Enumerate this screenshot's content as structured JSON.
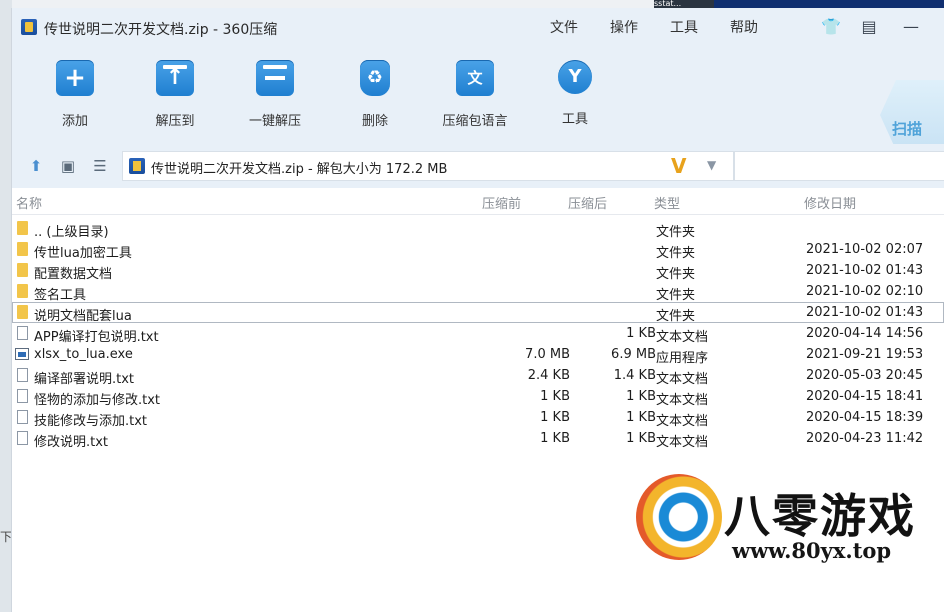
{
  "window": {
    "title": "传世说明二次开发文档.zip - 360压缩",
    "background_tab": "sstat..."
  },
  "menu": {
    "file": "文件",
    "operation": "操作",
    "tools": "工具",
    "help": "帮助"
  },
  "toolbar": {
    "add": "添加",
    "extract_to": "解压到",
    "one_click_extract": "一键解压",
    "delete": "删除",
    "archive_language": "压缩包语言",
    "tools": "工具",
    "scan": "扫描"
  },
  "address": {
    "path": "传世说明二次开发文档.zip - 解包大小为 172.2 MB",
    "vip": "V"
  },
  "columns": {
    "name": "名称",
    "compressed": "压缩前",
    "original": "压缩后",
    "type": "类型",
    "modified": "修改日期"
  },
  "rows": [
    {
      "name": ".. (上级目录)",
      "compressed": "",
      "original": "",
      "type": "文件夹",
      "date": "",
      "kind": "folder"
    },
    {
      "name": "传世lua加密工具",
      "compressed": "",
      "original": "",
      "type": "文件夹",
      "date": "2021-10-02 02:07",
      "kind": "folder"
    },
    {
      "name": "配置数据文档",
      "compressed": "",
      "original": "",
      "type": "文件夹",
      "date": "2021-10-02 01:43",
      "kind": "folder"
    },
    {
      "name": "签名工具",
      "compressed": "",
      "original": "",
      "type": "文件夹",
      "date": "2021-10-02 02:10",
      "kind": "folder"
    },
    {
      "name": "说明文档配套lua",
      "compressed": "",
      "original": "",
      "type": "文件夹",
      "date": "2021-10-02 01:43",
      "kind": "folder"
    },
    {
      "name": "APP编译打包说明.txt",
      "compressed": "",
      "original": "1 KB",
      "type": "文本文档",
      "date": "2020-04-14 14:56",
      "kind": "txt"
    },
    {
      "name": "xlsx_to_lua.exe",
      "compressed": "7.0 MB",
      "original": "6.9 MB",
      "type": "应用程序",
      "date": "2021-09-21 19:53",
      "kind": "exe"
    },
    {
      "name": "编译部署说明.txt",
      "compressed": "2.4 KB",
      "original": "1.4 KB",
      "type": "文本文档",
      "date": "2020-05-03 20:45",
      "kind": "txt"
    },
    {
      "name": "怪物的添加与修改.txt",
      "compressed": "1 KB",
      "original": "1 KB",
      "type": "文本文档",
      "date": "2020-04-15 18:41",
      "kind": "txt"
    },
    {
      "name": "技能修改与添加.txt",
      "compressed": "1 KB",
      "original": "1 KB",
      "type": "文本文档",
      "date": "2020-04-15 18:39",
      "kind": "txt"
    },
    {
      "name": "修改说明.txt",
      "compressed": "1 KB",
      "original": "1 KB",
      "type": "文本文档",
      "date": "2020-04-23 11:42",
      "kind": "txt"
    }
  ],
  "selected_row": 4,
  "watermark": {
    "title": "八零游戏",
    "url": "www.80yx.top"
  },
  "left_strip": {
    "text": "下"
  }
}
